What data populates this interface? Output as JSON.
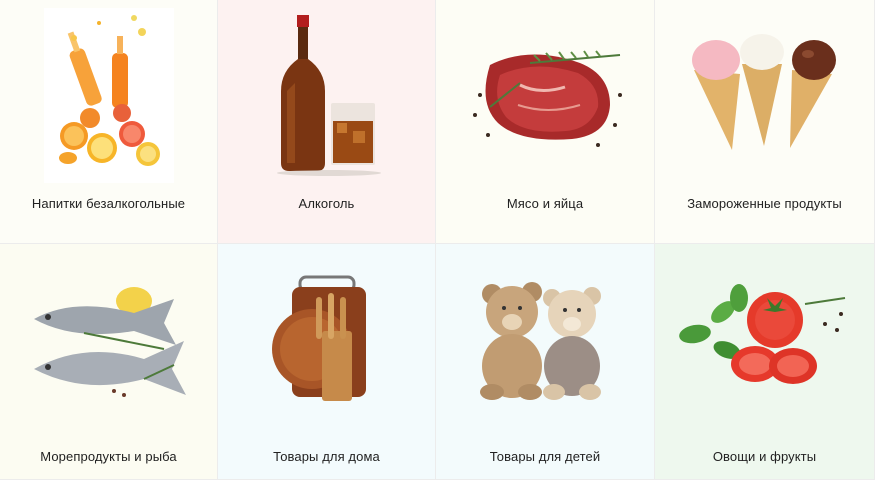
{
  "categories": [
    {
      "label": "Напитки безалкогольные",
      "icon": "soft-drinks-image",
      "bg": "#fdfdf7"
    },
    {
      "label": "Алкоголь",
      "icon": "alcohol-image",
      "bg": "#fdf2f1"
    },
    {
      "label": "Мясо и яйца",
      "icon": "meat-image",
      "bg": "#fdfdf5"
    },
    {
      "label": "Замороженные продукты",
      "icon": "ice-cream-image",
      "bg": "#fdfdf7"
    },
    {
      "label": "Морепродукты и рыба",
      "icon": "fish-image",
      "bg": "#fcfcf2"
    },
    {
      "label": "Товары для дома",
      "icon": "kitchen-boards-image",
      "bg": "#f3fbfd"
    },
    {
      "label": "Товары для детей",
      "icon": "teddy-bears-image",
      "bg": "#f3fbfc"
    },
    {
      "label": "Овощи и фрукты",
      "icon": "vegetables-image",
      "bg": "#eef8ee"
    }
  ]
}
